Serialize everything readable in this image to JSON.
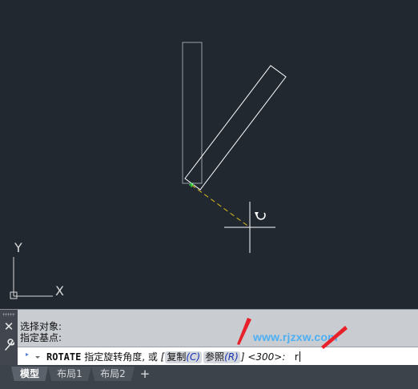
{
  "viewport": {
    "ucs_x_label": "X",
    "ucs_y_label": "Y",
    "rotate_cursor_icon": "rotate-arrow-icon"
  },
  "command": {
    "history": [
      "选择对象:",
      "指定基点:"
    ],
    "name": "ROTATE",
    "prompt": "指定旋转角度, 或",
    "bracket_open": "[",
    "option_copy_label": "复制",
    "option_copy_key": "(C)",
    "option_ref_label": "参照",
    "option_ref_key": "(R)",
    "bracket_close": "]",
    "default_value": "<300>:",
    "input_value": "r"
  },
  "watermark": "www.rjzxw.com",
  "tabs": [
    {
      "label": "模型",
      "active": true
    },
    {
      "label": "布局1",
      "active": false
    },
    {
      "label": "布局2",
      "active": false
    }
  ],
  "tab_add_label": "+",
  "colors": {
    "background": "#212830",
    "crosshair": "#ffffff",
    "rubberband": "#e3c31e",
    "basepoint": "#2ee23a",
    "arrow": "#e8202a"
  }
}
